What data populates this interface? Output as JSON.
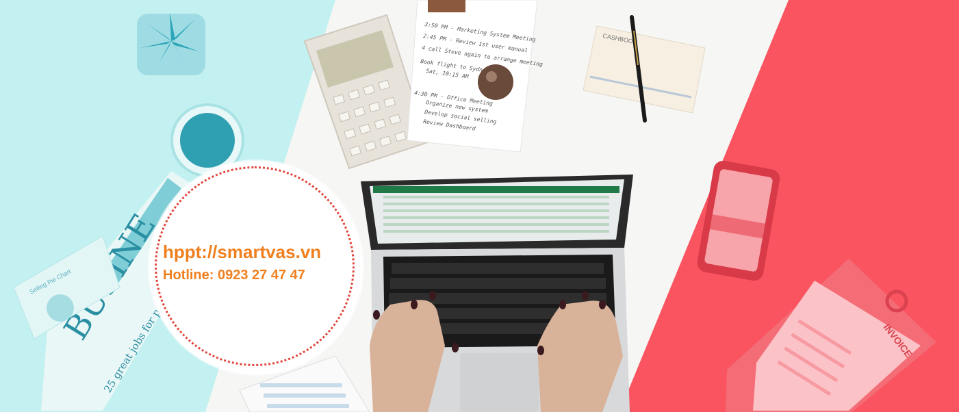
{
  "banner": {
    "url_text": "hppt://smartvas.vn",
    "hotline_text": "Hotline: 0923 27 47 47"
  },
  "props": {
    "newspaper_headline": "BUSINE",
    "newspaper_subline": "25 great jobs for people who love to travel",
    "chart_card_title": "Selling Pie Chart",
    "notebook_label": "CASHBOOK",
    "invoice_label": "INVOICE",
    "notes": [
      "3:50 PM - Marketing System Meeting",
      "2:45 PM - Review 1st user manual",
      "4 call Steve again to arrange meeting",
      "Book flight to Sydney",
      "Sat, 10:15 AM",
      "4:30 PM - Office Meeting",
      "Organize new system",
      "Develop social selling",
      "Review Dashboard"
    ]
  },
  "colors": {
    "left_tint": "#c3f0f0",
    "center": "#f6f6f4",
    "right_tint": "#f9545f",
    "accent_orange": "#f07f1e",
    "ring_red": "#e0463c"
  }
}
